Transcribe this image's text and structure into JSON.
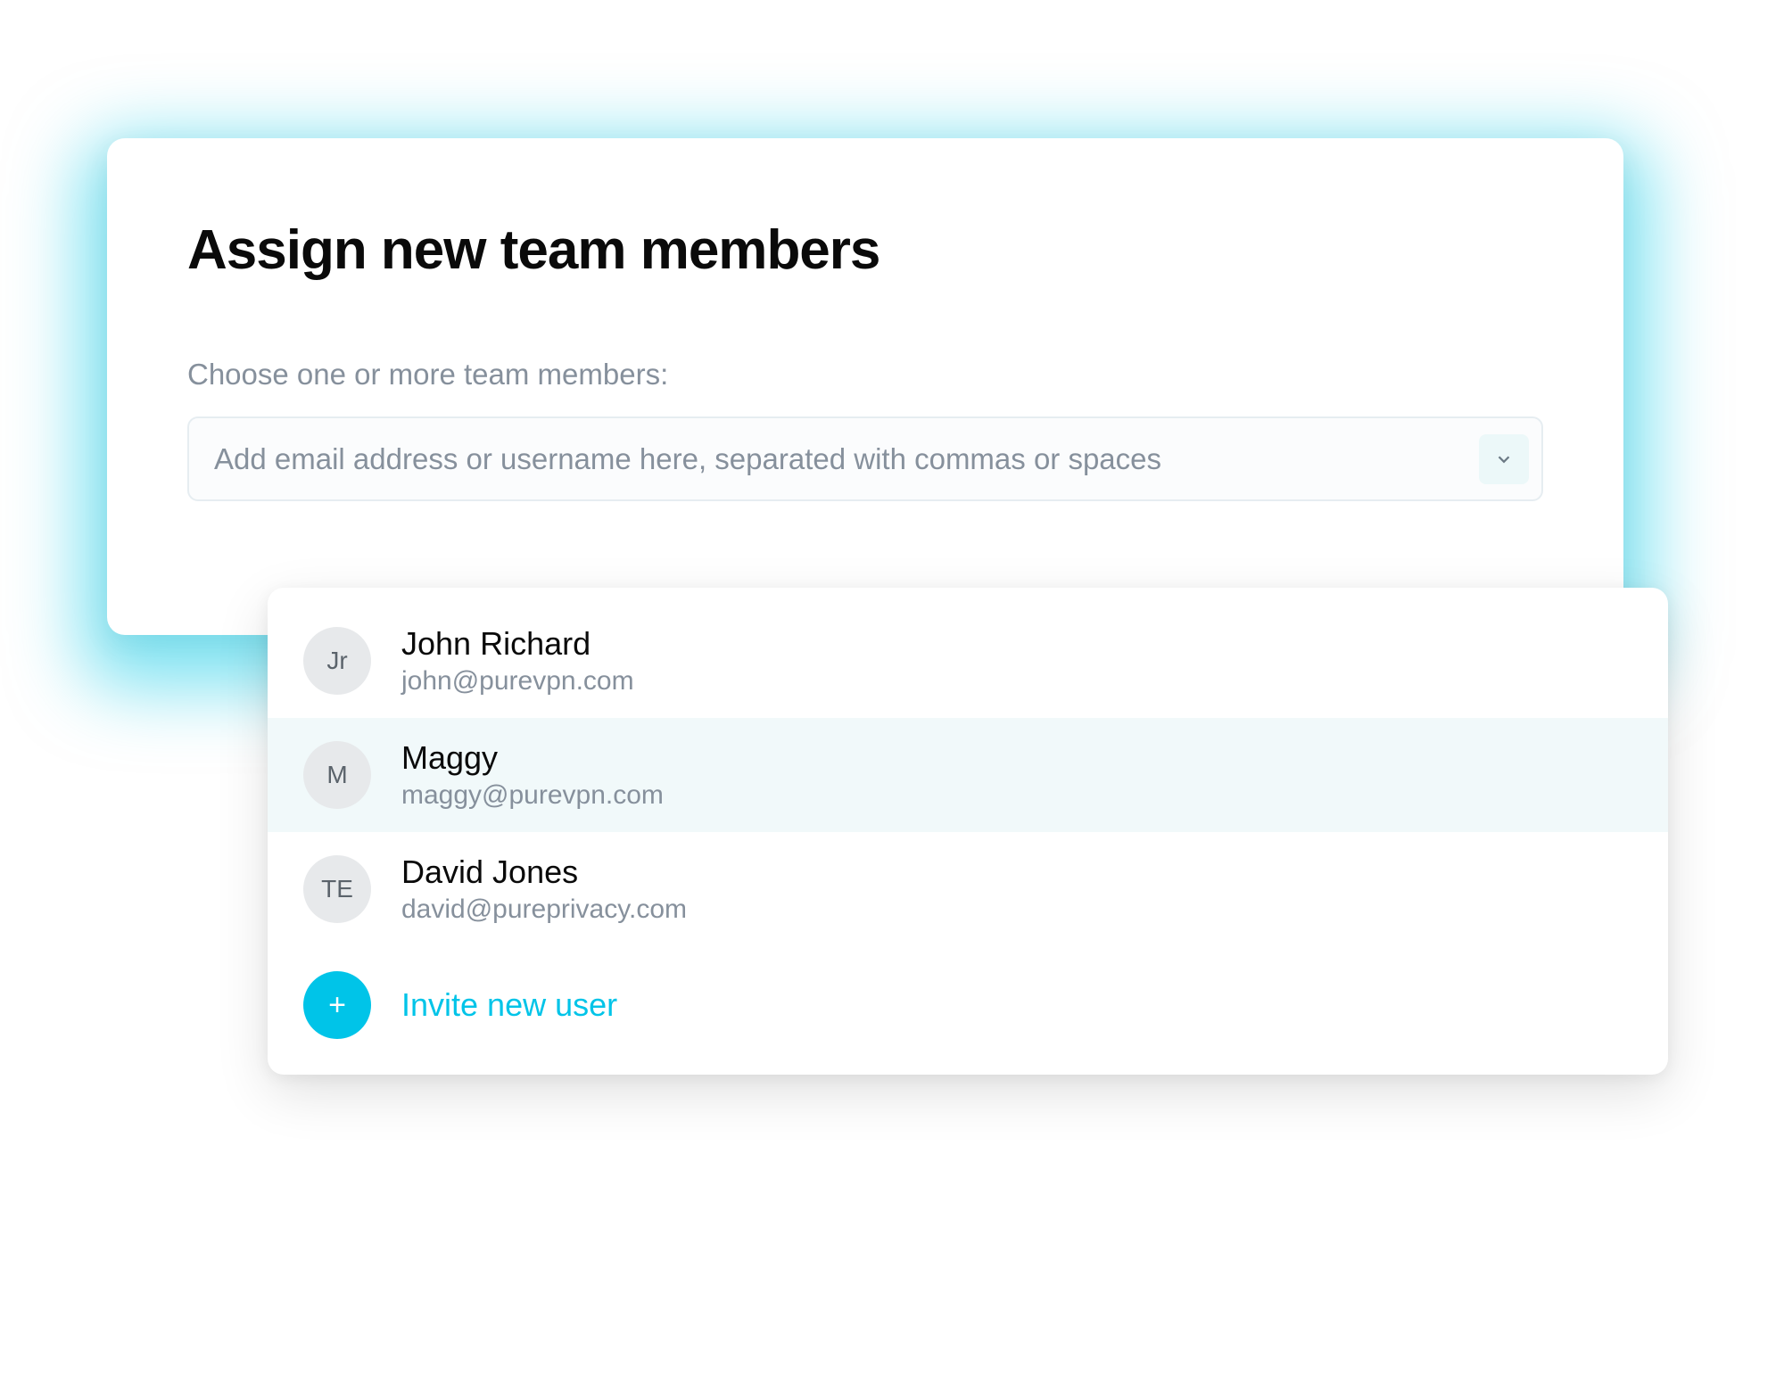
{
  "card": {
    "title": "Assign new team members",
    "subtitle": "Choose one or more team members:",
    "input_placeholder": "Add email address or username here, separated with commas or spaces"
  },
  "dropdown": {
    "members": [
      {
        "initials": "Jr",
        "name": "John Richard",
        "email": "john@purevpn.com",
        "highlight": false
      },
      {
        "initials": "M",
        "name": "Maggy",
        "email": "maggy@purevpn.com",
        "highlight": true
      },
      {
        "initials": "TE",
        "name": "David Jones",
        "email": "david@pureprivacy.com",
        "highlight": false
      }
    ],
    "invite_label": "Invite new user"
  },
  "colors": {
    "accent": "#00c4e8",
    "muted_text": "#86909c",
    "avatar_bg": "#e7e9eb"
  }
}
